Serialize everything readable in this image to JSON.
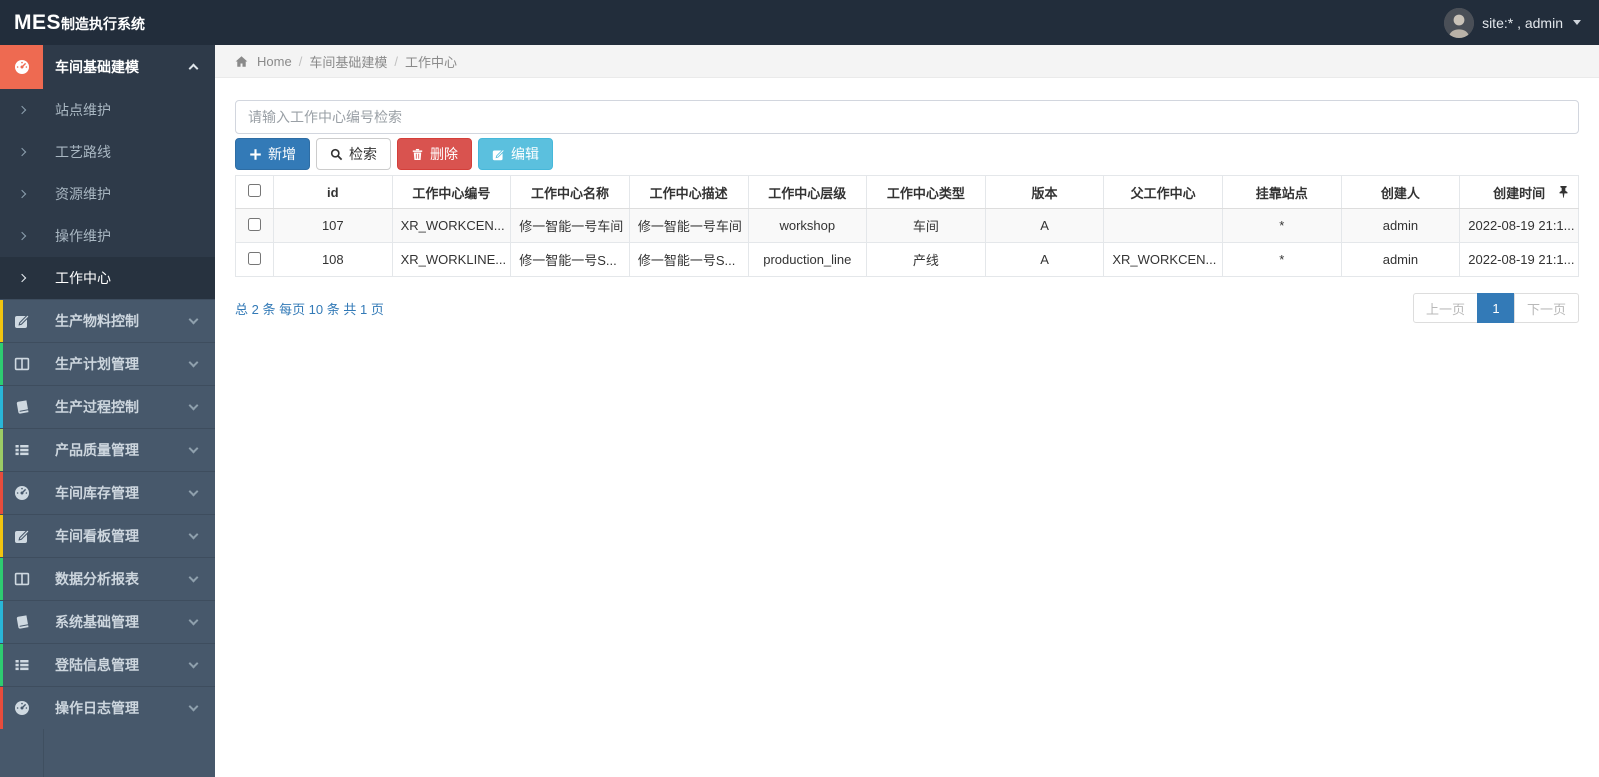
{
  "topbar": {
    "logo_primary": "MES",
    "logo_secondary": "制造执行系统",
    "user_label": "site:* , admin"
  },
  "breadcrumb": {
    "home": "Home",
    "sep": "/",
    "section": "车间基础建模",
    "current": "工作中心"
  },
  "sidebar": {
    "active_section": {
      "label": "车间基础建模",
      "icon": "dashboard-icon",
      "accent_color": "#ee6a51",
      "children": [
        {
          "label": "站点维护"
        },
        {
          "label": "工艺路线"
        },
        {
          "label": "资源维护"
        },
        {
          "label": "操作维护"
        },
        {
          "label": "工作中心"
        }
      ],
      "active_child": "工作中心"
    },
    "sections": [
      {
        "label": "生产物料控制",
        "icon": "edit-icon",
        "accent": "#f1c40f"
      },
      {
        "label": "生产计划管理",
        "icon": "columns-icon",
        "accent": "#2ecc71"
      },
      {
        "label": "生产过程控制",
        "icon": "book-icon",
        "accent": "#29b6d8"
      },
      {
        "label": "产品质量管理",
        "icon": "list-icon",
        "accent": "#9ccc65"
      },
      {
        "label": "车间库存管理",
        "icon": "dashboard-icon",
        "accent": "#e74c3c"
      },
      {
        "label": "车间看板管理",
        "icon": "edit-icon",
        "accent": "#f1c40f"
      },
      {
        "label": "数据分析报表",
        "icon": "columns-icon",
        "accent": "#2ecc71"
      },
      {
        "label": "系统基础管理",
        "icon": "book-icon",
        "accent": "#29b6d8"
      },
      {
        "label": "登陆信息管理",
        "icon": "list-icon",
        "accent": "#2ecc71"
      },
      {
        "label": "操作日志管理",
        "icon": "dashboard-icon",
        "accent": "#e74c3c"
      }
    ]
  },
  "toolbar": {
    "search_placeholder": "请输入工作中心编号检索",
    "add_label": "新增",
    "search_label": "检索",
    "delete_label": "删除",
    "edit_label": "编辑"
  },
  "table": {
    "columns": [
      "id",
      "工作中心编号",
      "工作中心名称",
      "工作中心描述",
      "工作中心层级",
      "工作中心类型",
      "版本",
      "父工作中心",
      "挂靠站点",
      "创建人",
      "创建时间"
    ],
    "rows": [
      [
        "107",
        "XR_WORKCEN...",
        "修一智能一号车间",
        "修一智能一号车间",
        "workshop",
        "车间",
        "A",
        "",
        "*",
        "admin",
        "2022-08-19 21:1..."
      ],
      [
        "108",
        "XR_WORKLINE...",
        "修一智能一号S...",
        "修一智能一号S...",
        "production_line",
        "产线",
        "A",
        "XR_WORKCEN...",
        "*",
        "admin",
        "2022-08-19 21:1..."
      ]
    ]
  },
  "pagination": {
    "summary": "总 2 条  每页 10 条  共 1 页",
    "prev_label": "上一页",
    "current_page": "1",
    "next_label": "下一页"
  },
  "colors": {
    "topbar_bg": "#222d3b",
    "sidebar_bg": "#47586b",
    "sidebar_expanded_bg": "#2e3a49",
    "active_icon_bg": "#ee6a51",
    "primary": "#337ab7",
    "danger": "#d9534f",
    "info": "#5bc0de",
    "link_blue": "#337ab7"
  }
}
